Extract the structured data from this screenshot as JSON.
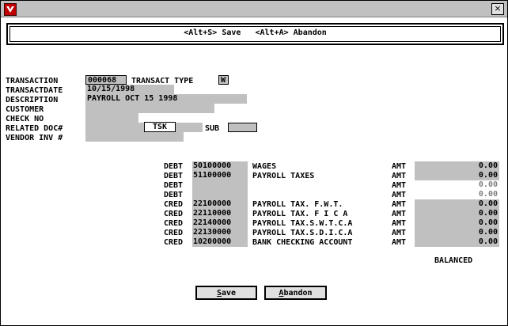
{
  "window": {
    "close_glyph": "×"
  },
  "shortcuts": "<Alt+S> Save   <Alt+A> Abandon",
  "form": {
    "transaction_label": "TRANSACTION",
    "transaction_value": "000068",
    "transact_type_label": "TRANSACT TYPE",
    "transact_type_value": "W",
    "transactdate_label": "TRANSACTDATE",
    "transactdate_value": "10/15/1998",
    "description_label": "DESCRIPTION",
    "description_value": "PAYROLL OCT 15 1998",
    "customer_label": "CUSTOMER",
    "customer_value": "",
    "check_no_label": "CHECK NO",
    "check_no_value": "",
    "related_doc_label": "RELATED DOC#",
    "related_doc_value": "",
    "tsk_label": "TSK",
    "sub_label": "SUB",
    "sub_value": "",
    "vendor_inv_label": "VENDOR INV #",
    "vendor_inv_value": ""
  },
  "ledger": {
    "amt_label": "AMT",
    "rows": [
      {
        "type": "DEBT",
        "account": "50100000",
        "desc": "WAGES",
        "amount": "0.00",
        "active": true
      },
      {
        "type": "DEBT",
        "account": "51100000",
        "desc": "PAYROLL TAXES",
        "amount": "0.00",
        "active": true
      },
      {
        "type": "DEBT",
        "account": "",
        "desc": "",
        "amount": "0.00",
        "active": false
      },
      {
        "type": "DEBT",
        "account": "",
        "desc": "",
        "amount": "0.00",
        "active": false
      },
      {
        "type": "CRED",
        "account": "22100000",
        "desc": "PAYROLL TAX. F.W.T.",
        "amount": "0.00",
        "active": true
      },
      {
        "type": "CRED",
        "account": "22110000",
        "desc": "PAYROLL TAX. F I C A",
        "amount": "0.00",
        "active": true
      },
      {
        "type": "CRED",
        "account": "22140000",
        "desc": "PAYROLL TAX.S.W.T.C.A",
        "amount": "0.00",
        "active": true
      },
      {
        "type": "CRED",
        "account": "22130000",
        "desc": "PAYROLL TAX.S.D.I.C.A",
        "amount": "0.00",
        "active": true
      },
      {
        "type": "CRED",
        "account": "10200000",
        "desc": "BANK CHECKING ACCOUNT",
        "amount": "0.00",
        "active": true
      }
    ],
    "status": "BALANCED"
  },
  "buttons": {
    "save_u": "S",
    "save_rest": "ave",
    "abandon_u": "A",
    "abandon_rest": "bandon"
  }
}
